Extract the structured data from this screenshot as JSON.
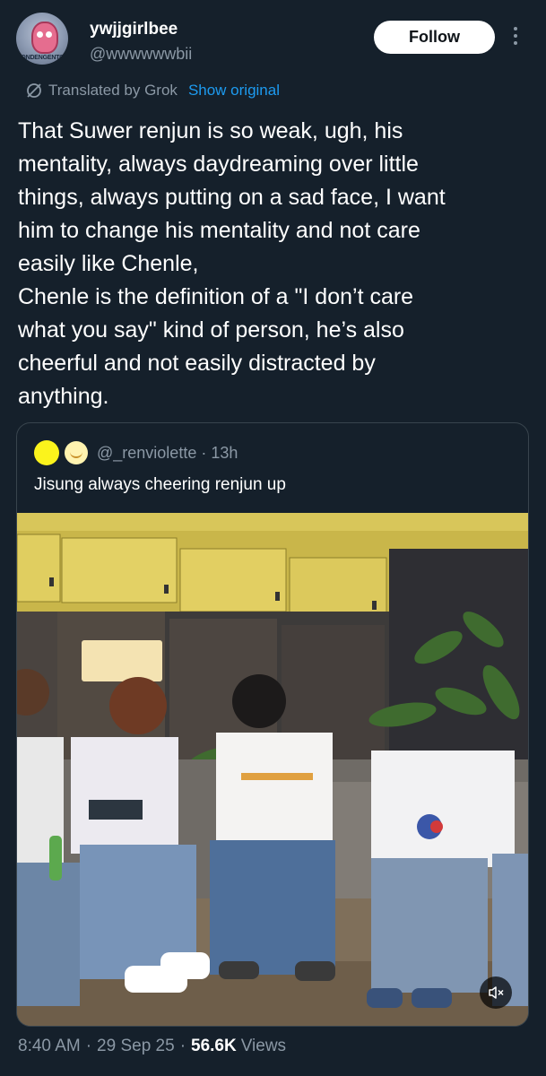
{
  "author": {
    "display_name": "ywjjgirlbee",
    "handle": "@wwwwwwbii",
    "avatar_caption": "RONDENGENTOT"
  },
  "actions": {
    "follow_label": "Follow",
    "more_icon": "more-vertical-icon"
  },
  "translation": {
    "icon": "grok-slash-icon",
    "label": "Translated by Grok",
    "show_original_label": "Show original",
    "link_color": "#1d9bf0"
  },
  "tweet": {
    "text": " That Suwer renjun is so weak, ugh, his\nmentality, always daydreaming over little\nthings, always putting on a sad face, I want\nhim to change his mentality and not care\neasily like Chenle,\nChenle is the definition of a \"I don’t care\nwhat you say\" kind of person, he’s also\ncheerful and not easily distracted by\nanything."
  },
  "quoted_tweet": {
    "handle": "@_renviolette",
    "separator": "·",
    "time": "13h",
    "text": "Jisung always cheering renjun up",
    "media": {
      "type": "video",
      "mute_icon": "speaker-muted-icon"
    }
  },
  "meta": {
    "time": "8:40 AM",
    "separator": "·",
    "date": "29 Sep 25",
    "views_count": "56.6K",
    "views_label": "Views"
  },
  "colors": {
    "background": "#15202b",
    "secondary_text": "#8b98a5",
    "border": "#38444d"
  }
}
